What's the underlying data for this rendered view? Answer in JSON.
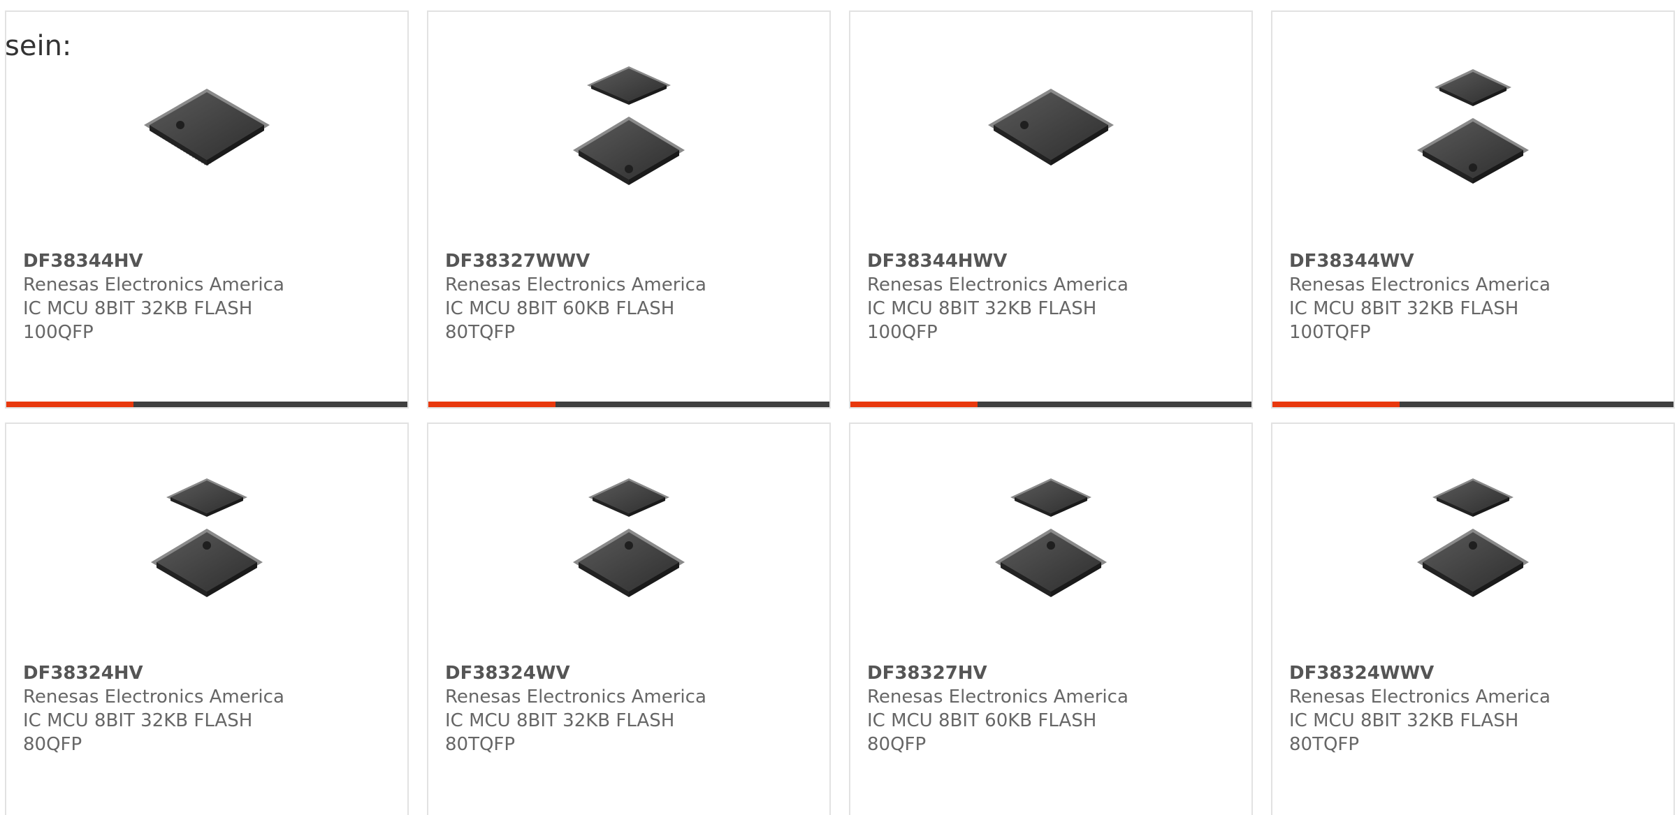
{
  "intro_text": "sein:",
  "colors": {
    "accent": "#e8380d",
    "bar_dark": "#3f3f3f",
    "card_border": "#e2e2e2",
    "text": "#666666"
  },
  "products": [
    {
      "part_number": "DF38344HV",
      "manufacturer": "Renesas Electronics America",
      "description": "IC MCU 8BIT 32KB FLASH 100QFP",
      "image_icon": "single-qfp-chip-icon"
    },
    {
      "part_number": "DF38327WWV",
      "manufacturer": "Renesas Electronics America",
      "description": "IC MCU 8BIT 60KB FLASH 80TQFP",
      "image_icon": "dual-qfp-chip-icon"
    },
    {
      "part_number": "DF38344HWV",
      "manufacturer": "Renesas Electronics America",
      "description": "IC MCU 8BIT 32KB FLASH 100QFP",
      "image_icon": "single-qfp-chip-icon"
    },
    {
      "part_number": "DF38344WV",
      "manufacturer": "Renesas Electronics America",
      "description": "IC MCU 8BIT 32KB FLASH 100TQFP",
      "image_icon": "dual-qfp-chip-icon"
    },
    {
      "part_number": "DF38324HV",
      "manufacturer": "Renesas Electronics America",
      "description": "IC MCU 8BIT 32KB FLASH 80QFP",
      "image_icon": "dual-qfp-chip-icon"
    },
    {
      "part_number": "DF38324WV",
      "manufacturer": "Renesas Electronics America",
      "description": "IC MCU 8BIT 32KB FLASH 80TQFP",
      "image_icon": "dual-qfp-chip-icon"
    },
    {
      "part_number": "DF38327HV",
      "manufacturer": "Renesas Electronics America",
      "description": "IC MCU 8BIT 60KB FLASH 80QFP",
      "image_icon": "dual-qfp-chip-icon"
    },
    {
      "part_number": "DF38324WWV",
      "manufacturer": "Renesas Electronics America",
      "description": "IC MCU 8BIT 32KB FLASH 80TQFP",
      "image_icon": "dual-qfp-chip-icon"
    }
  ]
}
